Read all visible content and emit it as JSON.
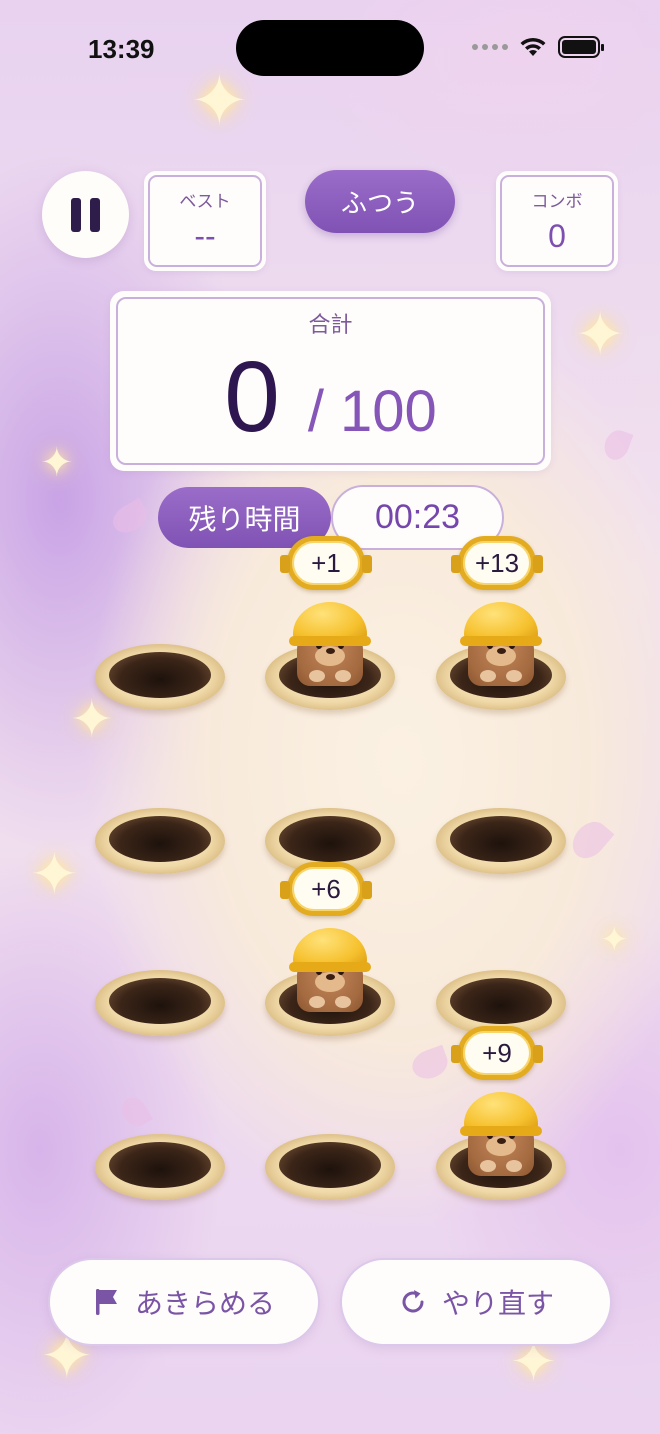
{
  "status_bar": {
    "time": "13:39"
  },
  "hud": {
    "pause_icon": "pause-icon",
    "best": {
      "label": "ベスト",
      "value": "--"
    },
    "difficulty": "ふつう",
    "combo": {
      "label": "コンボ",
      "value": "0"
    }
  },
  "total": {
    "label": "合計",
    "score": "0",
    "separator": "/",
    "target": "100"
  },
  "timer": {
    "label": "残り時間",
    "value": "00:23"
  },
  "board": {
    "holes": [
      {
        "row": 1,
        "col": 1,
        "mole": false,
        "points": ""
      },
      {
        "row": 1,
        "col": 2,
        "mole": true,
        "points": "+1"
      },
      {
        "row": 1,
        "col": 3,
        "mole": true,
        "points": "+13"
      },
      {
        "row": 2,
        "col": 1,
        "mole": false,
        "points": ""
      },
      {
        "row": 2,
        "col": 2,
        "mole": false,
        "points": ""
      },
      {
        "row": 2,
        "col": 3,
        "mole": false,
        "points": ""
      },
      {
        "row": 3,
        "col": 1,
        "mole": false,
        "points": ""
      },
      {
        "row": 3,
        "col": 2,
        "mole": true,
        "points": "+6"
      },
      {
        "row": 3,
        "col": 3,
        "mole": false,
        "points": ""
      },
      {
        "row": 4,
        "col": 1,
        "mole": false,
        "points": ""
      },
      {
        "row": 4,
        "col": 2,
        "mole": false,
        "points": ""
      },
      {
        "row": 4,
        "col": 3,
        "mole": true,
        "points": "+9"
      }
    ]
  },
  "actions": {
    "give_up": {
      "label": "あきらめる",
      "icon": "flag-icon"
    },
    "retry": {
      "label": "やり直す",
      "icon": "refresh-icon"
    }
  },
  "colors": {
    "accent": "#8a5cc0",
    "text_dark": "#2e1650",
    "sign_border": "#e3ab20"
  }
}
